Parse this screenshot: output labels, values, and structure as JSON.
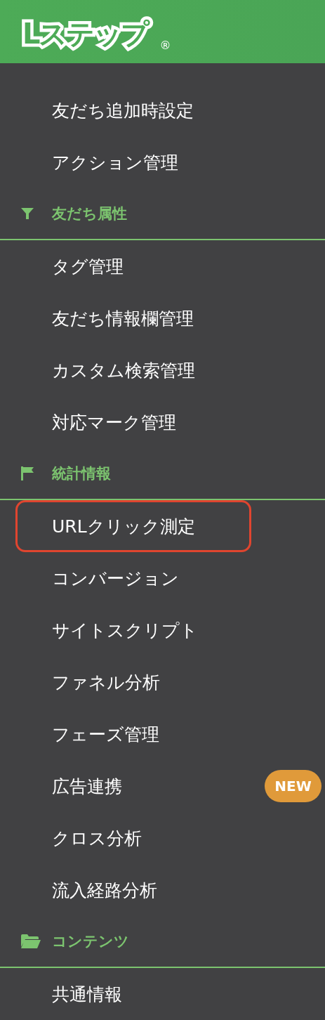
{
  "header": {
    "logo": "Lステップ",
    "registered": "®"
  },
  "menu": [
    {
      "kind": "item",
      "label": "友だち追加時設定",
      "highlighted": false
    },
    {
      "kind": "item",
      "label": "アクション管理",
      "highlighted": false
    },
    {
      "kind": "section",
      "label": "友だち属性"
    },
    {
      "kind": "item",
      "label": "タグ管理",
      "highlighted": false
    },
    {
      "kind": "item",
      "label": "友だち情報欄管理",
      "highlighted": false
    },
    {
      "kind": "item",
      "label": "カスタム検索管理",
      "highlighted": false
    },
    {
      "kind": "item",
      "label": "対応マーク管理",
      "highlighted": false
    },
    {
      "kind": "section",
      "label": "統計情報"
    },
    {
      "kind": "item",
      "label": "URLクリック測定",
      "highlighted": true
    },
    {
      "kind": "item",
      "label": "コンバージョン",
      "highlighted": false
    },
    {
      "kind": "item",
      "label": "サイトスクリプト",
      "highlighted": false
    },
    {
      "kind": "item",
      "label": "ファネル分析",
      "highlighted": false
    },
    {
      "kind": "item",
      "label": "フェーズ管理",
      "highlighted": false
    },
    {
      "kind": "item",
      "label": "広告連携",
      "highlighted": false,
      "badge": "NEW"
    },
    {
      "kind": "item",
      "label": "クロス分析",
      "highlighted": false
    },
    {
      "kind": "item",
      "label": "流入経路分析",
      "highlighted": false
    },
    {
      "kind": "section",
      "label": "コンテンツ"
    },
    {
      "kind": "item",
      "label": "共通情報",
      "highlighted": false
    }
  ]
}
